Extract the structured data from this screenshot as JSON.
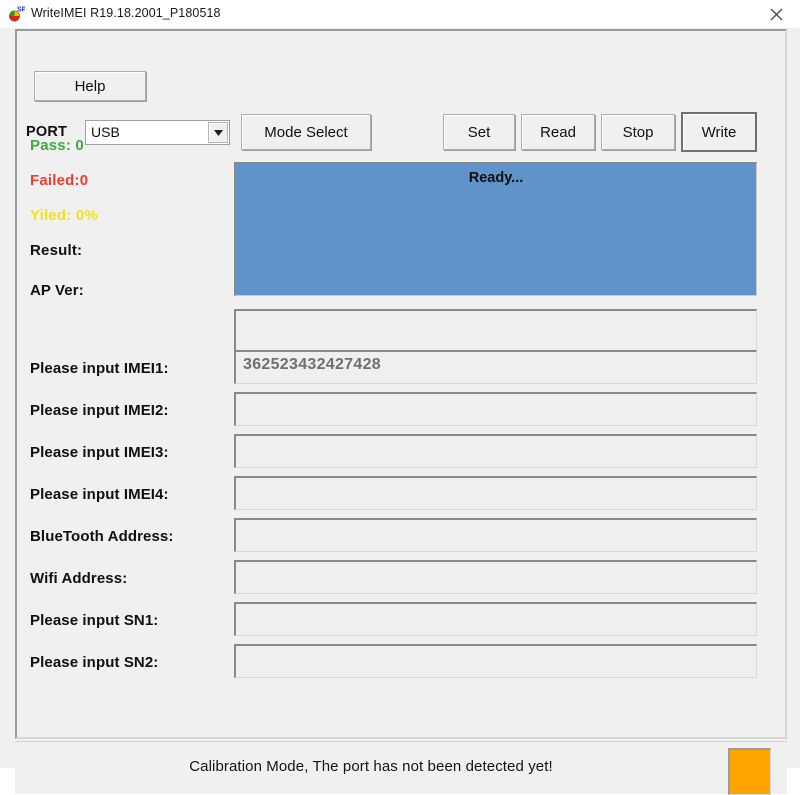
{
  "window": {
    "title": "WriteIMEI R19.18.2001_P180518",
    "icon": "app-ball-icon",
    "close_label": "✕"
  },
  "toolbar": {
    "help_label": "Help",
    "port_label": "PORT",
    "port_value": "USB",
    "port_options": [
      "USB"
    ],
    "mode_select_label": "Mode Select",
    "set_label": "Set",
    "read_label": "Read",
    "stop_label": "Stop",
    "write_label": "Write"
  },
  "stats": [
    {
      "name": "pass",
      "text": "Pass:  0",
      "color": "#3faa3f"
    },
    {
      "name": "failed",
      "text": "Failed:0",
      "color": "#f03b30"
    },
    {
      "name": "yiled",
      "text": "Yiled: 0%",
      "color": "#f2e218"
    },
    {
      "name": "result",
      "text": "Result:",
      "color": "#101010"
    }
  ],
  "message_panel": {
    "text": "Ready...",
    "background": "#6093c9"
  },
  "fields": [
    {
      "name": "ap-ver",
      "label": "AP Ver:",
      "value": ""
    },
    {
      "name": "imei1",
      "label": "Please input IMEI1:",
      "value": "362523432427428"
    },
    {
      "name": "imei2",
      "label": "Please input IMEI2:",
      "value": ""
    },
    {
      "name": "imei3",
      "label": "Please input IMEI3:",
      "value": ""
    },
    {
      "name": "imei4",
      "label": "Please input IMEI4:",
      "value": ""
    },
    {
      "name": "bluetooth",
      "label": "BlueTooth Address:",
      "value": ""
    },
    {
      "name": "wifi",
      "label": "Wifi Address:",
      "value": ""
    },
    {
      "name": "sn1",
      "label": "Please input SN1:",
      "value": ""
    },
    {
      "name": "sn2",
      "label": "Please input SN2:",
      "value": ""
    }
  ],
  "statusbar": {
    "text": "Calibration Mode, The port has not been detected yet!",
    "indicator_color": "#ffa400"
  }
}
